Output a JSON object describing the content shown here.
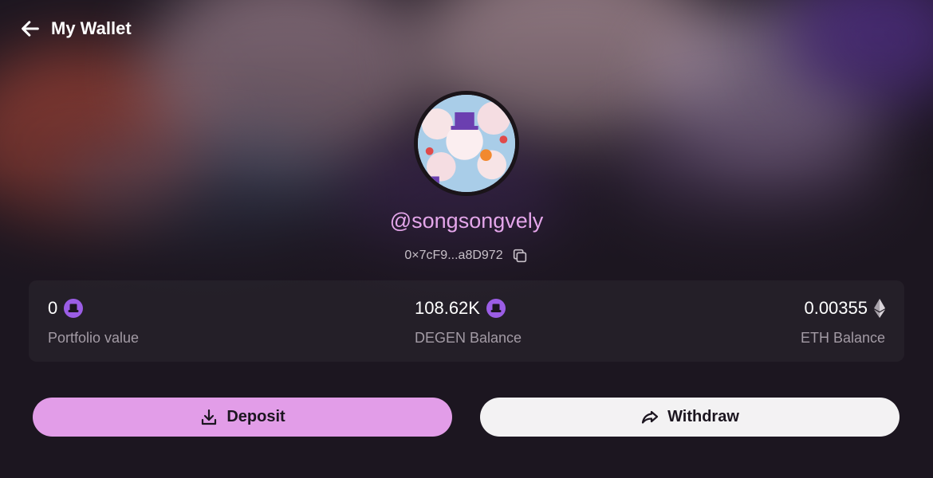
{
  "header": {
    "title": "My Wallet",
    "back_icon": "arrow-left-icon"
  },
  "profile": {
    "username": "@songsongvely",
    "address": "0×7cF9...a8D972",
    "copy_icon": "copy-icon"
  },
  "stats": [
    {
      "value": "0",
      "label": "Portfolio value",
      "icon": "degen-hat-icon"
    },
    {
      "value": "108.62K",
      "label": "DEGEN Balance",
      "icon": "degen-hat-icon"
    },
    {
      "value": "0.00355",
      "label": "ETH Balance",
      "icon": "eth-icon"
    }
  ],
  "actions": {
    "deposit_label": "Deposit",
    "deposit_icon": "download-icon",
    "withdraw_label": "Withdraw",
    "withdraw_icon": "share-arrow-icon"
  },
  "colors": {
    "accent": "#e29de8",
    "username": "#e4a6ea",
    "degen": "#9b5de5",
    "background": "#1c1620"
  }
}
